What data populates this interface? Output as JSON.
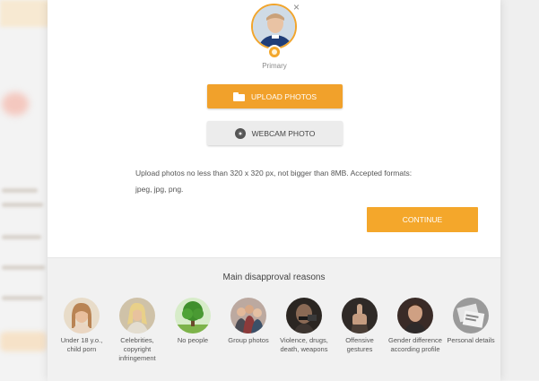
{
  "modal": {
    "close_symbol": "×",
    "primary_label": "Primary",
    "upload_button": "UPLOAD PHOTOS",
    "webcam_button": "WEBCAM PHOTO",
    "hint_text": "Upload photos no less than 320 x 320 px, not bigger than 8MB. Accepted formats: jpeg, jpg, png.",
    "continue_button": "CONTINUE",
    "accent_color": "#f1a12b"
  },
  "disapproval": {
    "title": "Main disapproval reasons",
    "items": [
      {
        "label": "Under 18 y.o., child porn",
        "icon": "young-girl-photo"
      },
      {
        "label": "Celebrities, copyright infringement",
        "icon": "celebrity-photo"
      },
      {
        "label": "No people",
        "icon": "tree-photo"
      },
      {
        "label": "Group photos",
        "icon": "group-photo"
      },
      {
        "label": "Violence, drugs, death, weapons",
        "icon": "weapon-photo"
      },
      {
        "label": "Offensive gestures",
        "icon": "gesture-photo"
      },
      {
        "label": "Gender difference according profile",
        "icon": "man-photo"
      },
      {
        "label": "Personal details",
        "icon": "documents-photo"
      }
    ]
  }
}
